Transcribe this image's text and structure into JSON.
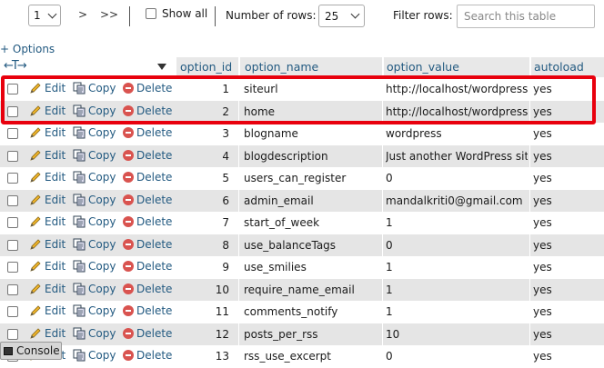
{
  "toolbar": {
    "page_value": "1",
    "next_label": ">",
    "last_label": ">>",
    "show_all_label": "Show all",
    "rows_label": "Number of rows:",
    "rows_value": "25",
    "filter_label": "Filter rows:",
    "filter_placeholder": "Search this table"
  },
  "options_link": "+ Options",
  "columns": {
    "option_id": "option_id",
    "option_name": "option_name",
    "option_value": "option_value",
    "autoload": "autoload"
  },
  "actions": {
    "edit": "Edit",
    "copy": "Copy",
    "delete": "Delete"
  },
  "rows": [
    {
      "id": "1",
      "name": "siteurl",
      "value": "http://localhost/wordpress",
      "autoload": "yes"
    },
    {
      "id": "2",
      "name": "home",
      "value": "http://localhost/wordpress",
      "autoload": "yes"
    },
    {
      "id": "3",
      "name": "blogname",
      "value": "wordpress",
      "autoload": "yes"
    },
    {
      "id": "4",
      "name": "blogdescription",
      "value": "Just another WordPress site",
      "autoload": "yes"
    },
    {
      "id": "5",
      "name": "users_can_register",
      "value": "0",
      "autoload": "yes"
    },
    {
      "id": "6",
      "name": "admin_email",
      "value": "mandalkriti0@gmail.com",
      "autoload": "yes"
    },
    {
      "id": "7",
      "name": "start_of_week",
      "value": "1",
      "autoload": "yes"
    },
    {
      "id": "8",
      "name": "use_balanceTags",
      "value": "0",
      "autoload": "yes"
    },
    {
      "id": "9",
      "name": "use_smilies",
      "value": "1",
      "autoload": "yes"
    },
    {
      "id": "10",
      "name": "require_name_email",
      "value": "1",
      "autoload": "yes"
    },
    {
      "id": "11",
      "name": "comments_notify",
      "value": "1",
      "autoload": "yes"
    },
    {
      "id": "12",
      "name": "posts_per_rss",
      "value": "10",
      "autoload": "yes"
    },
    {
      "id": "13",
      "name": "rss_use_excerpt",
      "value": "0",
      "autoload": "yes"
    }
  ],
  "console_label": "Console",
  "colors": {
    "link": "#235a81",
    "highlight": "#e8000d",
    "row_alt": "#e5e5e5",
    "delete": "#d9534f"
  }
}
